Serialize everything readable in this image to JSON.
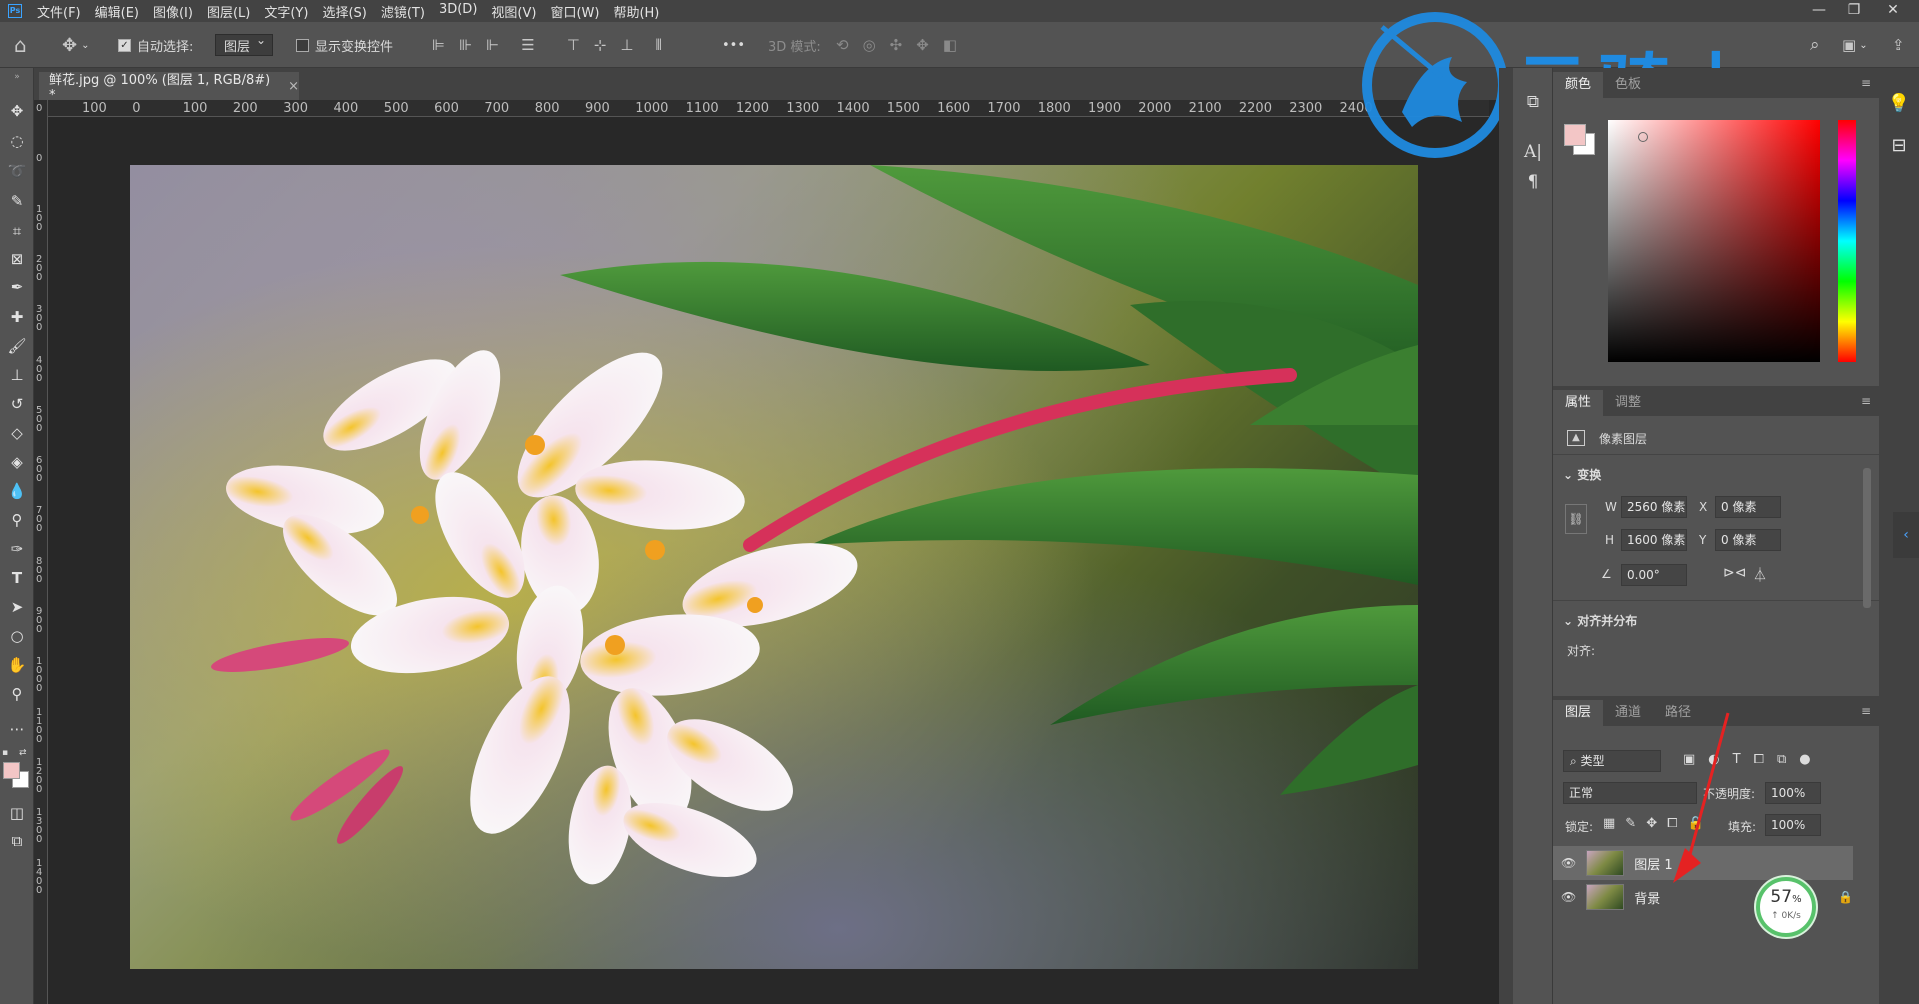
{
  "menu": [
    "文件(F)",
    "编辑(E)",
    "图像(I)",
    "图层(L)",
    "文字(Y)",
    "选择(S)",
    "滤镜(T)",
    "3D(D)",
    "视图(V)",
    "窗口(W)",
    "帮助(H)"
  ],
  "window_controls": {
    "minimize": "—",
    "restore": "❐",
    "close": "✕"
  },
  "options": {
    "auto_select_label": "自动选择:",
    "auto_select_target": "图层",
    "show_transform_label": "显示变换控件",
    "more": "•••",
    "mode_3d_label": "3D 模式:"
  },
  "document": {
    "tab_title": "鲜花.jpg @ 100% (图层 1, RGB/8#) *",
    "tab_close": "×"
  },
  "ruler_h": [
    "100",
    "0",
    "100",
    "200",
    "300",
    "400",
    "500",
    "600",
    "700",
    "800",
    "900",
    "1000",
    "1100",
    "1200",
    "1300",
    "1400",
    "1500",
    "1600",
    "1700",
    "1800",
    "1900",
    "2000",
    "2100",
    "2200",
    "2300",
    "2400"
  ],
  "ruler_v": [
    "0",
    "0",
    "1 0 0",
    "2 0 0",
    "3 0 0",
    "4 0 0",
    "5 0 0",
    "6 0 0",
    "7 0 0",
    "8 0 0",
    "9 0 0",
    "1 0 0 0",
    "1 1 0 0",
    "1 2 0 0",
    "1 3 0 0",
    "1 4 0 0"
  ],
  "watermark": {
    "text": "云骑士",
    "color": "#1f8ae0"
  },
  "color_panel": {
    "tabs": [
      "颜色",
      "色板"
    ],
    "foreground": "#f3c6c6",
    "background": "#ffffff"
  },
  "properties": {
    "tabs": [
      "属性",
      "调整"
    ],
    "layer_kind": "像素图层",
    "transform_label": "变换",
    "w_label": "W",
    "w_value": "2560 像素",
    "h_label": "H",
    "h_value": "1600 像素",
    "x_label": "X",
    "x_value": "0 像素",
    "y_label": "Y",
    "y_value": "0 像素",
    "angle_value": "0.00°",
    "align_section": "对齐并分布",
    "align_label": "对齐:"
  },
  "layers": {
    "tabs": [
      "图层",
      "通道",
      "路径"
    ],
    "filter_kind": "类型",
    "blend_mode": "正常",
    "opacity_label": "不透明度:",
    "opacity_value": "100%",
    "lock_label": "锁定:",
    "fill_label": "填充:",
    "fill_value": "100%",
    "items": [
      {
        "name": "图层 1",
        "selected": true
      },
      {
        "name": "背景",
        "selected": false,
        "locked": true
      }
    ]
  },
  "speed_widget": {
    "percent": "57",
    "unit": "%",
    "rate": "0K/s"
  }
}
